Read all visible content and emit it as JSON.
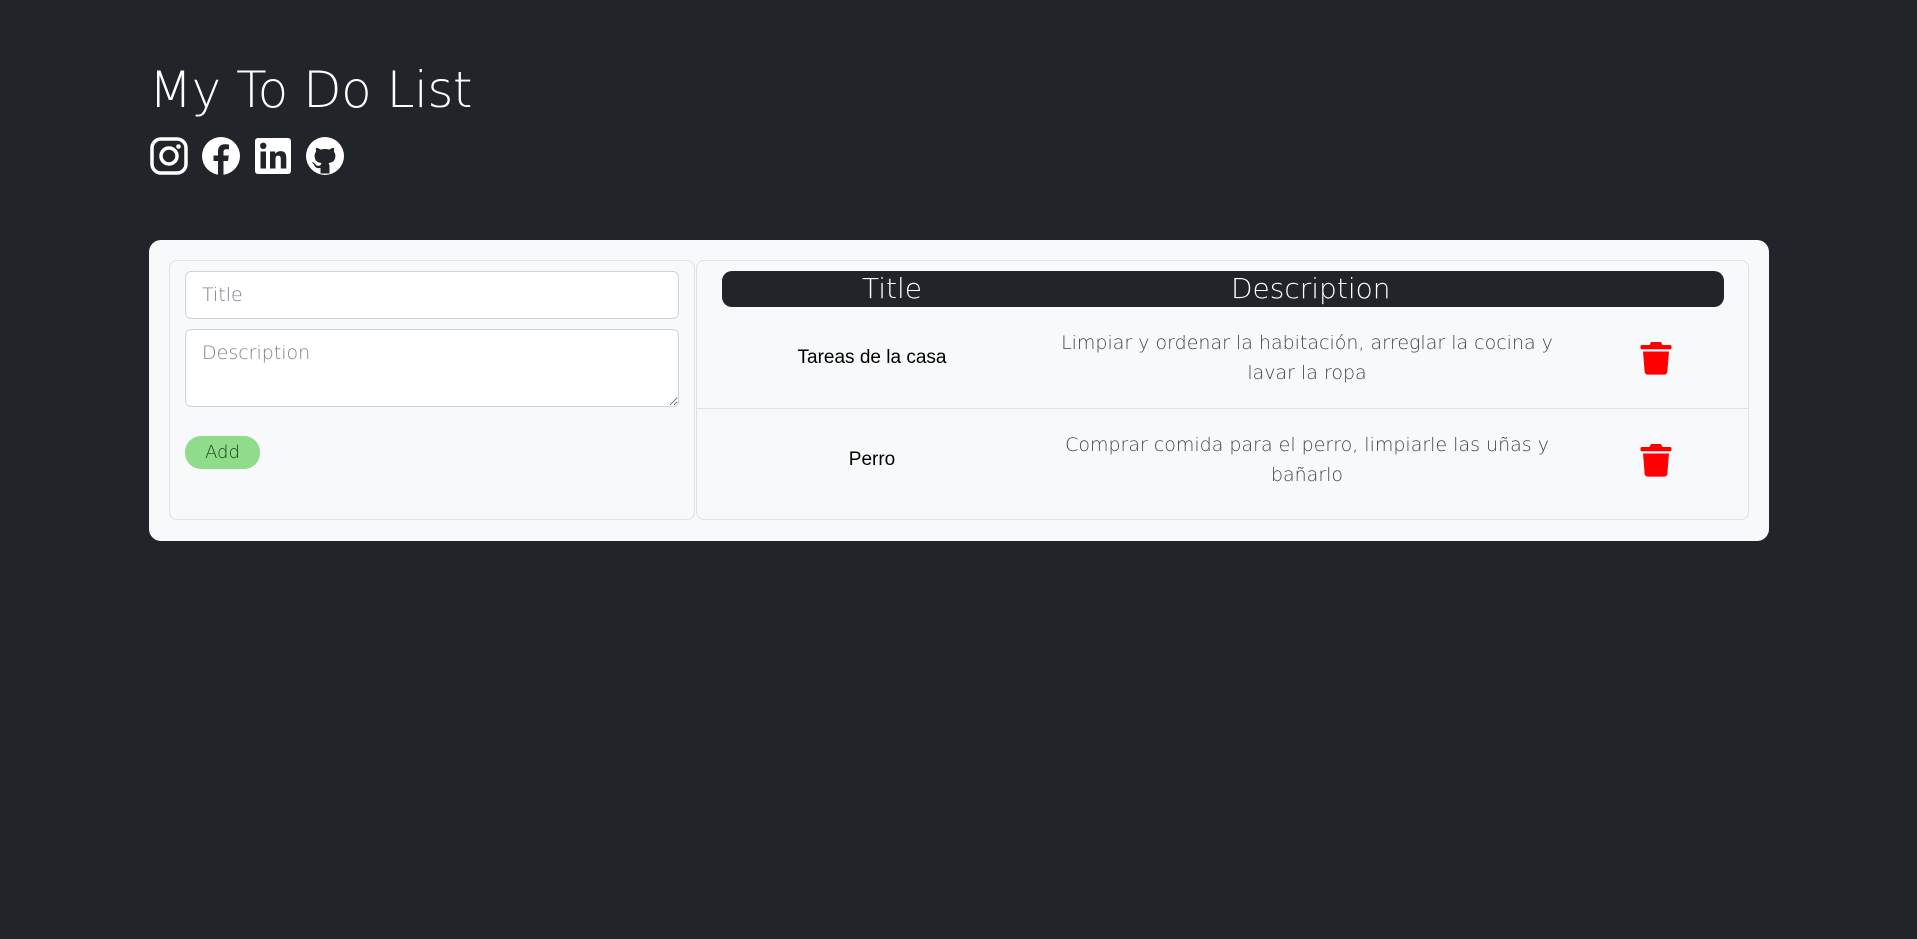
{
  "header": {
    "title": "My To Do List",
    "socials": [
      {
        "icon": "instagram-icon"
      },
      {
        "icon": "facebook-icon"
      },
      {
        "icon": "linkedin-icon"
      },
      {
        "icon": "github-icon"
      }
    ]
  },
  "form": {
    "title_placeholder": "Title",
    "description_placeholder": "Description",
    "add_label": "Add"
  },
  "table": {
    "columns": [
      "Title",
      "Description"
    ],
    "rows": [
      {
        "title": "Tareas de la casa",
        "description": "Limpiar y ordenar la habitación, arreglar la cocina y lavar la ropa",
        "action_icon": "trash-icon"
      },
      {
        "title": "Perro",
        "description": "Comprar comida para el perro, limpiarle las uñas y bañarlo",
        "action_icon": "trash-icon"
      }
    ]
  },
  "colors": {
    "background": "#212529",
    "card": "#f8f9fa",
    "add_button": "#8fdc8b",
    "delete": "#ff0000"
  }
}
